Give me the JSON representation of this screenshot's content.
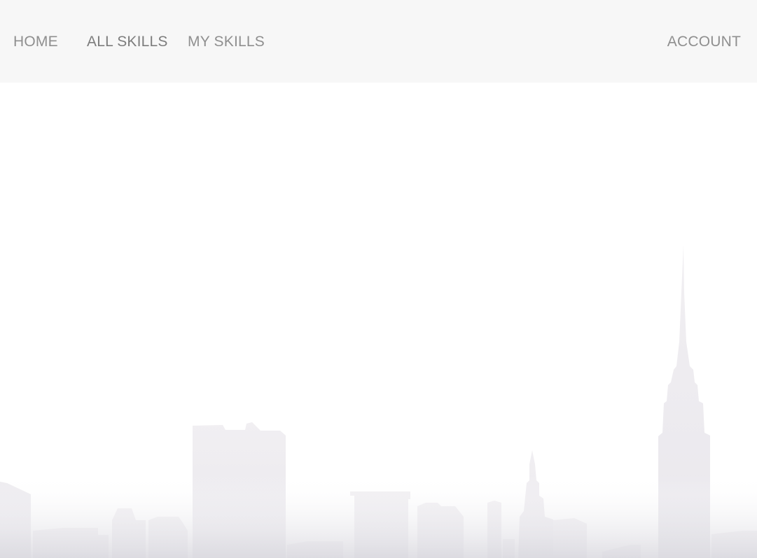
{
  "nav": {
    "items": [
      {
        "label": "HOME"
      },
      {
        "label": "ALL SKILLS"
      },
      {
        "label": "MY SKILLS"
      }
    ],
    "account_label": "ACCOUNT"
  },
  "colors": {
    "navbar_bg": "#f7f7f7",
    "nav_text": "#8f8f8f",
    "skyline": "#e6e4e9"
  }
}
